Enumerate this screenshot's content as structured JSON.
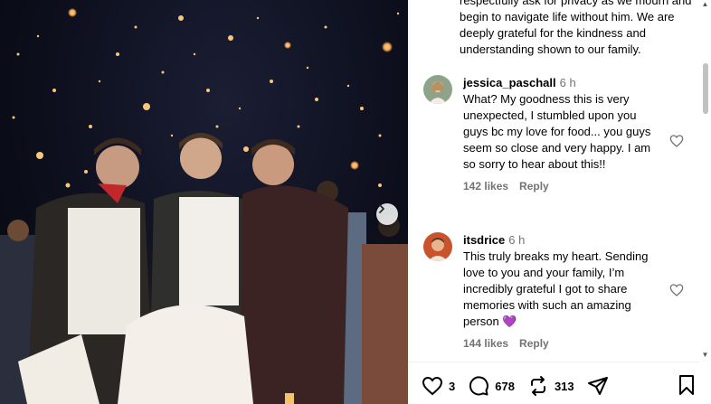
{
  "post": {
    "caption_tail": "respectfully ask for privacy as we mourn and begin to navigate life without him. We are deeply grateful for the kindness and understanding shown to our family."
  },
  "comments": [
    {
      "username": "jessica_paschall",
      "time": "6 h",
      "text": "What? My goodness this is very unexpected, I stumbled upon you guys bc my love for food... you guys seem so close and very happy. I am so sorry to hear about this!!",
      "likes": "142 likes",
      "reply_label": "Reply"
    },
    {
      "username": "itsdrice",
      "time": "6 h",
      "text": "This truly breaks my heart. Sending love to you and your family, I’m incredibly grateful I got to share memories with such an amazing person 💜",
      "likes": "144 likes",
      "reply_label": "Reply"
    }
  ],
  "actions": {
    "like_count": "3",
    "comment_count": "678",
    "repost_count": "313"
  },
  "icons": {
    "next": "chevron-right-icon",
    "like": "heart-icon",
    "comment": "comment-icon",
    "repost": "repost-icon",
    "share": "send-icon",
    "save": "bookmark-icon"
  },
  "colors": {
    "meta_gray": "#737373",
    "scroll_thumb": "#c1c1c1"
  }
}
